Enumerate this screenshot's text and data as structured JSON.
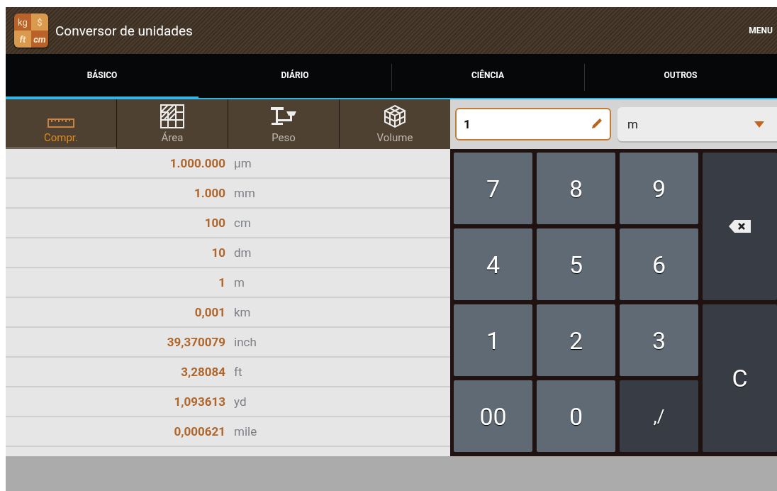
{
  "app_bar": {
    "logo": [
      "kg",
      "$",
      "ft",
      "cm"
    ],
    "title": "Conversor de unidades",
    "menu": "MENU"
  },
  "tabs": [
    {
      "label": "BÁSICO",
      "selected": true
    },
    {
      "label": "DIÁRIO",
      "selected": false
    },
    {
      "label": "CIÊNCIA",
      "selected": false
    },
    {
      "label": "OUTROS",
      "selected": false
    }
  ],
  "categories": [
    {
      "kind": "ruler",
      "label": "Compr.",
      "selected": true
    },
    {
      "kind": "area",
      "label": "Área",
      "selected": false
    },
    {
      "kind": "scale",
      "label": "Peso",
      "selected": false
    },
    {
      "kind": "cube",
      "label": "Volume",
      "selected": false
    }
  ],
  "results": [
    {
      "value": "1.000.000",
      "unit": "µm"
    },
    {
      "value": "1.000",
      "unit": "mm"
    },
    {
      "value": "100",
      "unit": "cm"
    },
    {
      "value": "10",
      "unit": "dm"
    },
    {
      "value": "1",
      "unit": "m"
    },
    {
      "value": "0,001",
      "unit": "km"
    },
    {
      "value": "39,370079",
      "unit": "inch"
    },
    {
      "value": "3,28084",
      "unit": "ft"
    },
    {
      "value": "1,093613",
      "unit": "yd"
    },
    {
      "value": "0,000621",
      "unit": "mile"
    }
  ],
  "input": {
    "value": "1"
  },
  "unit_select": {
    "value": "m"
  },
  "keypad": [
    {
      "kind": "digit",
      "label": "7"
    },
    {
      "kind": "digit",
      "label": "8"
    },
    {
      "kind": "digit",
      "label": "9"
    },
    {
      "kind": "backspace"
    },
    {
      "kind": "digit",
      "label": "4"
    },
    {
      "kind": "digit",
      "label": "5"
    },
    {
      "kind": "digit",
      "label": "6"
    },
    {
      "kind": "digit",
      "label": "1"
    },
    {
      "kind": "digit",
      "label": "2"
    },
    {
      "kind": "digit",
      "label": "3"
    },
    {
      "kind": "clear",
      "label": "C"
    },
    {
      "kind": "digit",
      "label": "00"
    },
    {
      "kind": "digit",
      "label": "0"
    },
    {
      "kind": "dark",
      "label": ",/"
    }
  ]
}
